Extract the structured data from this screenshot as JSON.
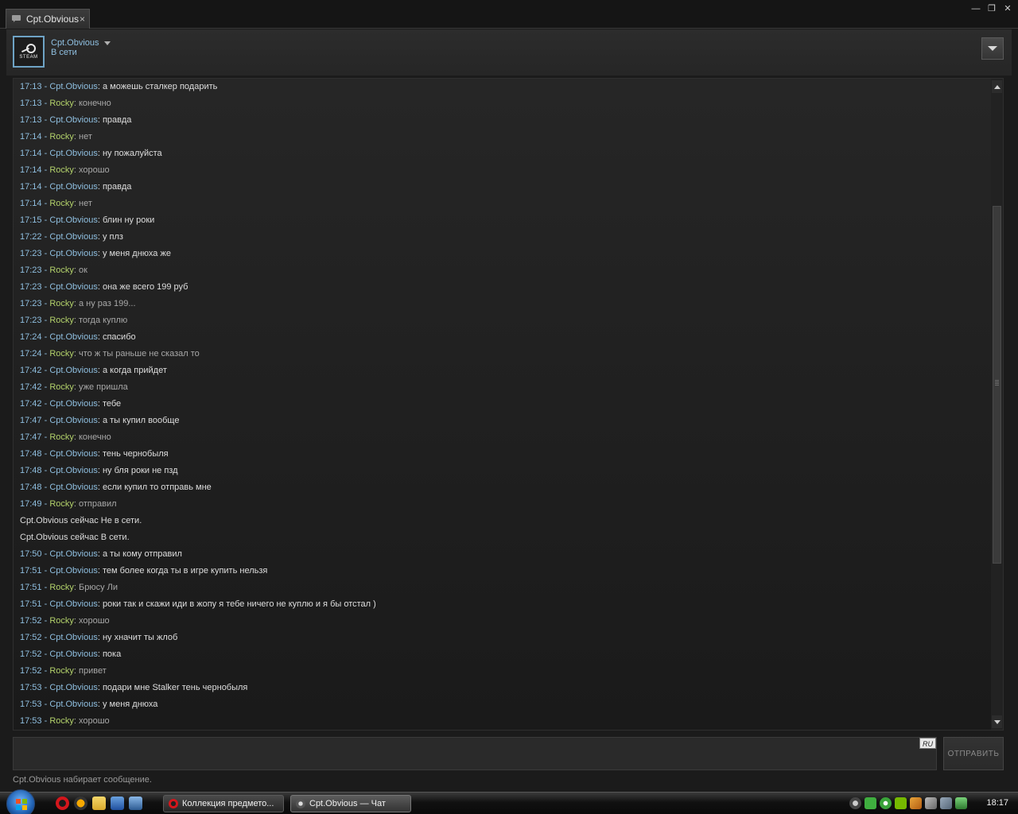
{
  "window": {
    "tab_title": "Cpt.Obvious",
    "tab_close": "×",
    "controls": {
      "minimize": "—",
      "restore": "❐",
      "close": "✕"
    }
  },
  "header": {
    "avatar_text": "STEAM",
    "name": "Cpt.Obvious",
    "status": "В сети"
  },
  "messages": [
    {
      "time": "17:13",
      "author": "Cpt.Obvious",
      "text": "а можешь сталкер подарить"
    },
    {
      "time": "17:13",
      "author": "Rocky",
      "text": "конечно"
    },
    {
      "time": "17:13",
      "author": "Cpt.Obvious",
      "text": "правда"
    },
    {
      "time": "17:14",
      "author": "Rocky",
      "text": "нет"
    },
    {
      "time": "17:14",
      "author": "Cpt.Obvious",
      "text": "ну пожалуйста"
    },
    {
      "time": "17:14",
      "author": "Rocky",
      "text": "хорошо"
    },
    {
      "time": "17:14",
      "author": "Cpt.Obvious",
      "text": "правда"
    },
    {
      "time": "17:14",
      "author": "Rocky",
      "text": "нет"
    },
    {
      "time": "17:15",
      "author": "Cpt.Obvious",
      "text": "блин ну роки"
    },
    {
      "time": "17:22",
      "author": "Cpt.Obvious",
      "text": "у плз"
    },
    {
      "time": "17:23",
      "author": "Cpt.Obvious",
      "text": "у меня днюха же"
    },
    {
      "time": "17:23",
      "author": "Rocky",
      "text": "ок"
    },
    {
      "time": "17:23",
      "author": "Cpt.Obvious",
      "text": "она же всего 199 руб"
    },
    {
      "time": "17:23",
      "author": "Rocky",
      "text": "а ну раз 199..."
    },
    {
      "time": "17:23",
      "author": "Rocky",
      "text": "тогда куплю"
    },
    {
      "time": "17:24",
      "author": "Cpt.Obvious",
      "text": "спасибо"
    },
    {
      "time": "17:24",
      "author": "Rocky",
      "text": "что ж ты раньше не сказал то"
    },
    {
      "time": "17:42",
      "author": "Cpt.Obvious",
      "text": "а когда прийдет"
    },
    {
      "time": "17:42",
      "author": "Rocky",
      "text": "уже пришла"
    },
    {
      "time": "17:42",
      "author": "Cpt.Obvious",
      "text": "тебе"
    },
    {
      "time": "17:47",
      "author": "Cpt.Obvious",
      "text": "а ты купил вообще"
    },
    {
      "time": "17:47",
      "author": "Rocky",
      "text": "конечно"
    },
    {
      "time": "17:48",
      "author": "Cpt.Obvious",
      "text": "тень чернобыля"
    },
    {
      "time": "17:48",
      "author": "Cpt.Obvious",
      "text": "ну бля роки не пзд"
    },
    {
      "time": "17:48",
      "author": "Cpt.Obvious",
      "text": "если купил то отправь мне"
    },
    {
      "time": "17:49",
      "author": "Rocky",
      "text": "отправил"
    },
    {
      "system": "Cpt.Obvious сейчас Не в сети."
    },
    {
      "system": "Cpt.Obvious сейчас В сети."
    },
    {
      "time": "17:50",
      "author": "Cpt.Obvious",
      "text": "а ты кому отправил"
    },
    {
      "time": "17:51",
      "author": "Cpt.Obvious",
      "text": "тем более когда ты в игре купить нельзя"
    },
    {
      "time": "17:51",
      "author": "Rocky",
      "text": "Брюсу Ли"
    },
    {
      "time": "17:51",
      "author": "Cpt.Obvious",
      "text": "роки так и скажи иди в жопу я тебе ничего не куплю и я бы отстал )"
    },
    {
      "time": "17:52",
      "author": "Rocky",
      "text": "хорошо"
    },
    {
      "time": "17:52",
      "author": "Cpt.Obvious",
      "text": "ну хначит ты жлоб"
    },
    {
      "time": "17:52",
      "author": "Cpt.Obvious",
      "text": "пока"
    },
    {
      "time": "17:52",
      "author": "Rocky",
      "text": "привет"
    },
    {
      "time": "17:53",
      "author": "Cpt.Obvious",
      "text": "подари мне Stalker тень чернобыля"
    },
    {
      "time": "17:53",
      "author": "Cpt.Obvious",
      "text": "у меня днюха"
    },
    {
      "time": "17:53",
      "author": "Rocky",
      "text": "хорошо"
    }
  ],
  "input": {
    "value": "",
    "lang": "RU",
    "send_label": "ОТПРАВИТЬ"
  },
  "typing_status": "Cpt.Obvious набирает сообщение.",
  "taskbar": {
    "tasks": [
      {
        "label": "Коллекция предмето...",
        "icon": "opera-icon"
      },
      {
        "label": "Cpt.Obvious — Чат",
        "icon": "steam-icon"
      }
    ],
    "clock": "18:17"
  },
  "colors": {
    "time_and_obvious": "#8fbfe0",
    "rocky": "#b3d26b",
    "obvious_text": "#dedede",
    "rocky_text": "#a8a8a8",
    "background": "#1b1b1b"
  }
}
